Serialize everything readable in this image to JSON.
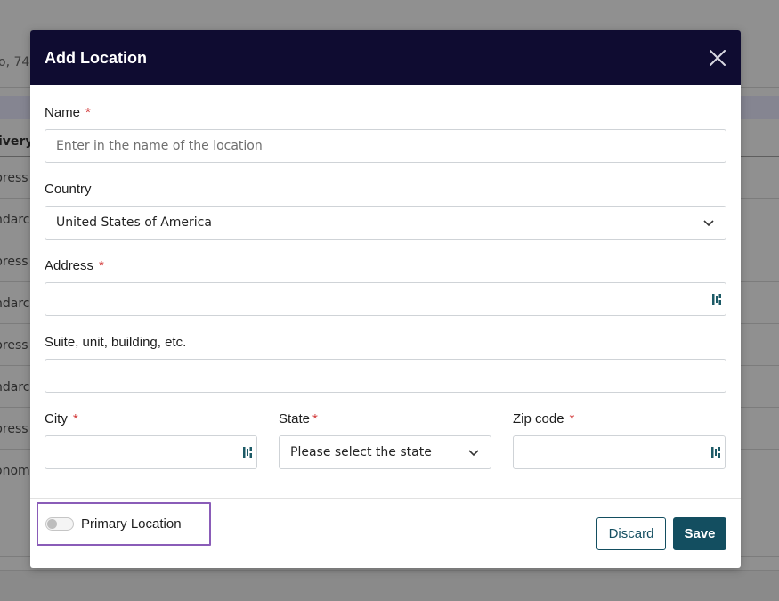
{
  "background": {
    "address_fragment": "o, 743",
    "column_header": "ivery",
    "rows": [
      "press",
      "ndarc",
      "press",
      "ndarc",
      "press",
      "ndarc",
      "press",
      "onom"
    ]
  },
  "modal": {
    "title": "Add Location",
    "fields": {
      "name": {
        "label": "Name",
        "required_mark": "*",
        "placeholder": "Enter in the name of the location",
        "value": ""
      },
      "country": {
        "label": "Country",
        "value": "United States of America"
      },
      "address": {
        "label": "Address",
        "required_mark": "*",
        "value": ""
      },
      "suite": {
        "label": "Suite, unit, building, etc.",
        "value": ""
      },
      "city": {
        "label": "City",
        "required_mark": "*",
        "value": ""
      },
      "state": {
        "label": "State",
        "required_mark": "*",
        "value": "Please select the state"
      },
      "zip": {
        "label": "Zip code",
        "required_mark": "*",
        "value": ""
      }
    },
    "footer": {
      "toggle_label": "Primary Location",
      "toggle_on": false,
      "discard_label": "Discard",
      "save_label": "Save"
    },
    "colors": {
      "header_bg": "#0f0c31",
      "accent": "#134e60",
      "required": "#d33a3a",
      "highlight_outline": "#8a5cb8"
    }
  }
}
